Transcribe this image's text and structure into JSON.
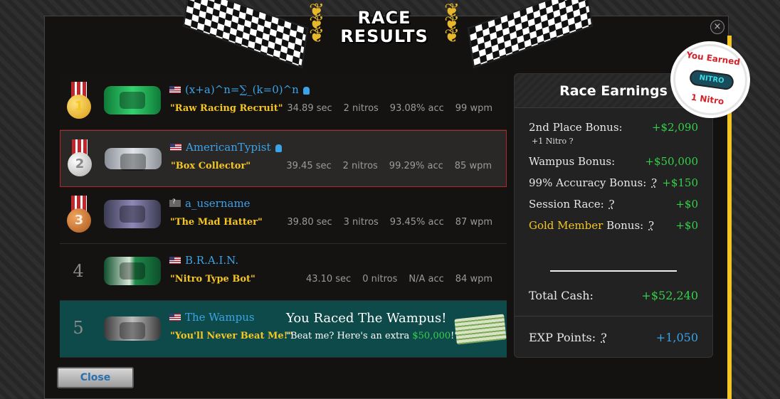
{
  "header": {
    "title_line1": "RACE",
    "title_line2": "RESULTS",
    "close_icon": "×"
  },
  "results": [
    {
      "place": "1",
      "medal": "gold",
      "username": "(x+a)^n=∑_(k=0)^n",
      "tagline": "\"Raw Racing Recruit\"",
      "time": "34.89 sec",
      "nitros": "2 nitros",
      "acc": "93.08% acc",
      "wpm": "99 wpm",
      "verified": true
    },
    {
      "place": "2",
      "medal": "silver",
      "username": "AmericanTypist",
      "tagline": "\"Box Collector\"",
      "time": "39.45 sec",
      "nitros": "2 nitros",
      "acc": "99.29% acc",
      "wpm": "85 wpm",
      "verified": true,
      "is_player": true
    },
    {
      "place": "3",
      "medal": "bronze",
      "username": "a_username",
      "tagline": "\"The Mad Hatter\"",
      "time": "39.80 sec",
      "nitros": "3 nitros",
      "acc": "93.45% acc",
      "wpm": "87 wpm"
    },
    {
      "place": "4",
      "username": "B.R.A.I.N.",
      "tagline": "\"Nitro Type Bot\"",
      "time": "43.10 sec",
      "nitros": "0 nitros",
      "acc": "N/A acc",
      "wpm": "84 wpm"
    },
    {
      "place": "5",
      "username": "The Wampus",
      "tagline": "\"You'll Never Beat Me!\"",
      "message": "You Raced The Wampus!",
      "sub_prefix": "\"Beat me? Here's an extra ",
      "sub_amount": "$50,000",
      "sub_suffix": "!\""
    }
  ],
  "earnings": {
    "title": "Race Earnings",
    "place_bonus_label": "2nd Place Bonus:",
    "place_bonus_value": "+$2,090",
    "nitro_note": "+1 Nitro",
    "q": "?",
    "wampus_label": "Wampus Bonus:",
    "wampus_value": "+$50,000",
    "accuracy_label": "99% Accuracy Bonus:",
    "accuracy_value": "+$150",
    "session_label": "Session Race:",
    "session_value": "+$0",
    "gold_label": "Gold Member",
    "gold_suffix": "Bonus:",
    "gold_value": "+$0",
    "total_label": "Total Cash:",
    "total_value": "+$52,240",
    "exp_label": "EXP Points:",
    "exp_value": "+1,050"
  },
  "badge": {
    "top": "You Earned",
    "item": "NITRO",
    "bottom": "1 Nitro"
  },
  "footer": {
    "close_label": "Close"
  },
  "colors": {
    "accent_gold": "#f3c623",
    "accent_green": "#35d04a",
    "accent_blue": "#3ba3e8",
    "player_border": "#b3262a",
    "wampus_row": "#0f4a4a"
  }
}
